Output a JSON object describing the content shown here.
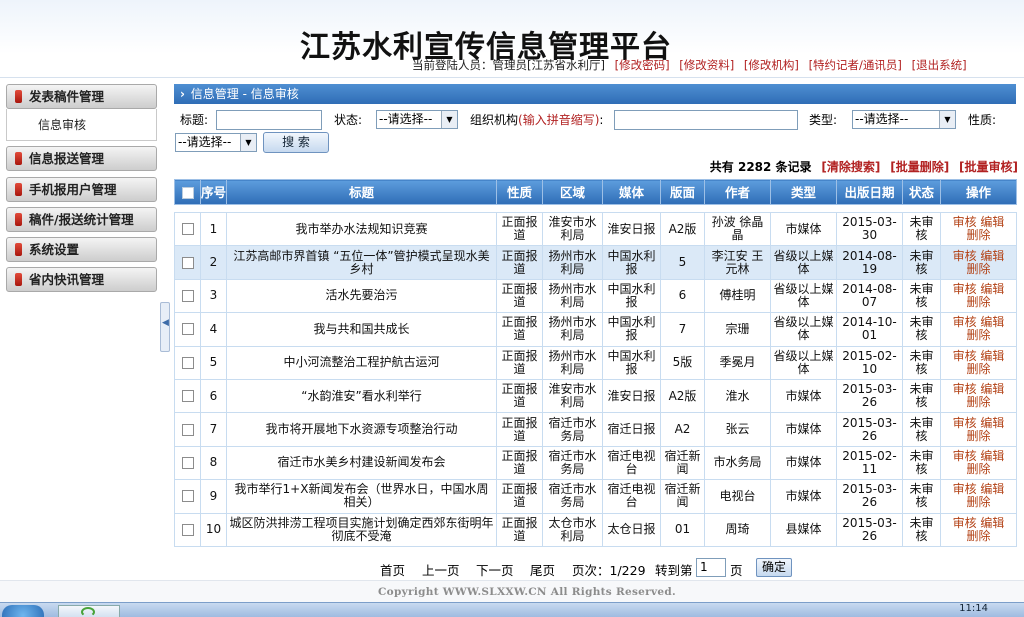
{
  "header": {
    "title": "江苏水利宣传信息管理平台",
    "current_user_label": "当前登陆人员：管理员[江苏省水利厅]",
    "links": [
      "[修改密码]",
      "[修改资料]",
      "[修改机构]",
      "[特约记者/通讯员]",
      "[退出系统]"
    ]
  },
  "sidebar": {
    "items": [
      "发表稿件管理",
      "信息报送管理",
      "手机报用户管理",
      "稿件/报送统计管理",
      "系统设置",
      "省内快讯管理"
    ],
    "submenu": "信息审核"
  },
  "breadcrumb": {
    "text": "信息管理 - 信息审核"
  },
  "filters": {
    "title_label": "标题:",
    "status_label": "状态:",
    "status_value": "--请选择--",
    "org_label": "组织机构",
    "org_hint": "(输入拼音缩写)",
    "org_colon": ":",
    "type_label": "类型:",
    "type_value": "--请选择--",
    "nature_label": "性质:",
    "nature_value": "--请选择--",
    "search_button": "搜 索"
  },
  "records": {
    "count_text": "共有 2282 条记录",
    "actions": [
      "[清除搜索]",
      "[批量删除]",
      "[批量审核]"
    ]
  },
  "table": {
    "headers": [
      "序号",
      "标题",
      "性质",
      "区域",
      "媒体",
      "版面",
      "作者",
      "类型",
      "出版日期",
      "状态",
      "操作"
    ],
    "op_labels": [
      "审核",
      "编辑",
      "删除"
    ],
    "rows": [
      {
        "no": "1",
        "title": "我市举办水法规知识竞赛",
        "nature": "正面报道",
        "region": "淮安市水利局",
        "media": "淮安日报",
        "page": "A2版",
        "author": "孙波 徐晶晶",
        "type": "市媒体",
        "date": "2015-03-30",
        "status": "未审核"
      },
      {
        "no": "2",
        "title": "江苏高邮市界首镇 “五位一体”管护模式呈现水美乡村",
        "nature": "正面报道",
        "region": "扬州市水利局",
        "media": "中国水利报",
        "page": "5",
        "author": "李江安 王元林",
        "type": "省级以上媒体",
        "date": "2014-08-19",
        "status": "未审核"
      },
      {
        "no": "3",
        "title": "活水先要治污",
        "nature": "正面报道",
        "region": "扬州市水利局",
        "media": "中国水利报",
        "page": "6",
        "author": "傅桂明",
        "type": "省级以上媒体",
        "date": "2014-08-07",
        "status": "未审核"
      },
      {
        "no": "4",
        "title": "我与共和国共成长",
        "nature": "正面报道",
        "region": "扬州市水利局",
        "media": "中国水利报",
        "page": "7",
        "author": "宗珊",
        "type": "省级以上媒体",
        "date": "2014-10-01",
        "status": "未审核"
      },
      {
        "no": "5",
        "title": "中小河流整治工程护航古运河",
        "nature": "正面报道",
        "region": "扬州市水利局",
        "media": "中国水利报",
        "page": "5版",
        "author": "季冕月",
        "type": "省级以上媒体",
        "date": "2015-02-10",
        "status": "未审核"
      },
      {
        "no": "6",
        "title": "“水韵淮安”看水利举行",
        "nature": "正面报道",
        "region": "淮安市水利局",
        "media": "淮安日报",
        "page": "A2版",
        "author": "淮水",
        "type": "市媒体",
        "date": "2015-03-26",
        "status": "未审核"
      },
      {
        "no": "7",
        "title": "我市将开展地下水资源专项整治行动",
        "nature": "正面报道",
        "region": "宿迁市水务局",
        "media": "宿迁日报",
        "page": "A2",
        "author": "张云",
        "type": "市媒体",
        "date": "2015-03-26",
        "status": "未审核"
      },
      {
        "no": "8",
        "title": "宿迁市水美乡村建设新闻发布会",
        "nature": "正面报道",
        "region": "宿迁市水务局",
        "media": "宿迁电视台",
        "page": "宿迁新闻",
        "author": "市水务局",
        "type": "市媒体",
        "date": "2015-02-11",
        "status": "未审核"
      },
      {
        "no": "9",
        "title": "我市举行1+X新闻发布会（世界水日，中国水周相关）",
        "nature": "正面报道",
        "region": "宿迁市水务局",
        "media": "宿迁电视台",
        "page": "宿迁新闻",
        "author": "电视台",
        "type": "市媒体",
        "date": "2015-03-26",
        "status": "未审核"
      },
      {
        "no": "10",
        "title": "城区防洪排涝工程项目实施计划确定西郊东街明年彻底不受淹",
        "nature": "正面报道",
        "region": "太仓市水利局",
        "media": "太仓日报",
        "page": "01",
        "author": "周琦",
        "type": "县媒体",
        "date": "2015-03-26",
        "status": "未审核"
      }
    ]
  },
  "pager": {
    "first": "首页",
    "prev": "上一页",
    "next": "下一页",
    "last": "尾页",
    "page_info": "页次：1/229",
    "goto_label": "转到第",
    "goto_value": "1",
    "page_unit": "页",
    "ok": "确定"
  },
  "footer": {
    "copyright": "Copyright WWW.SLXXW.CN All Rights Reserved."
  },
  "taskbar": {
    "clock": "11:14"
  }
}
